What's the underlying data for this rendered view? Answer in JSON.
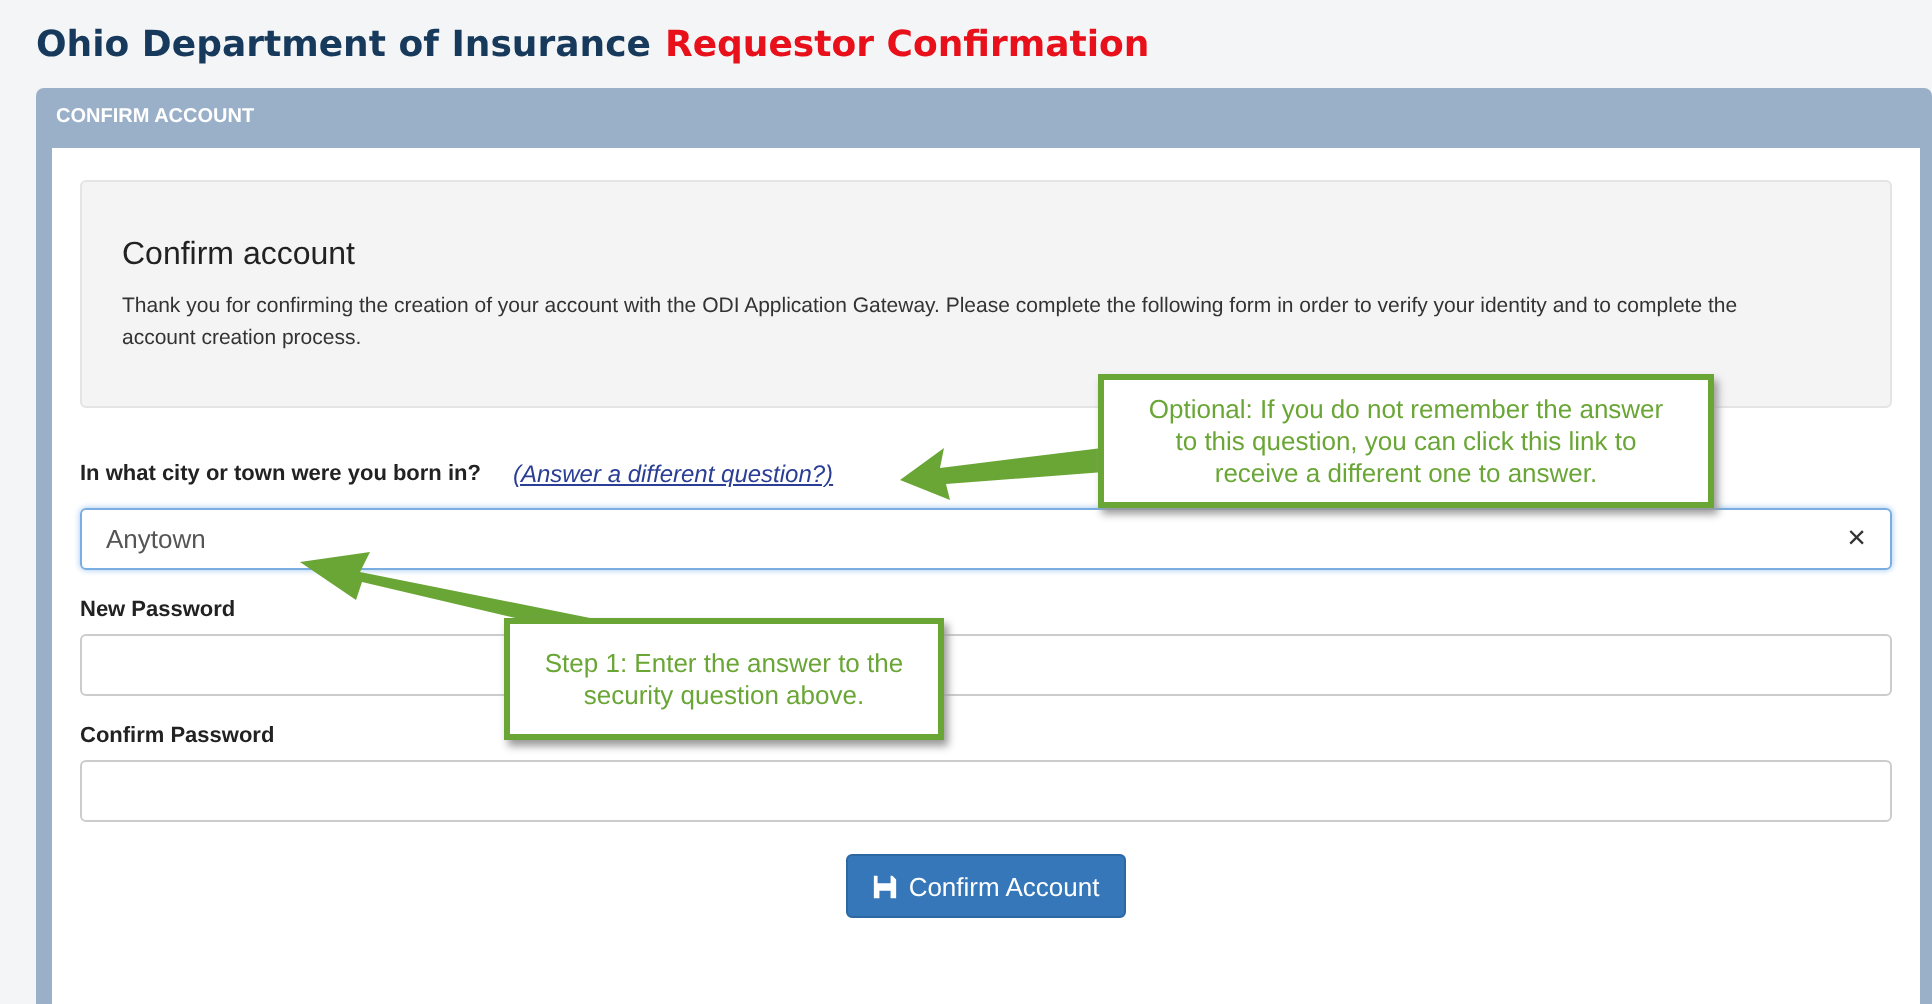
{
  "header": {
    "organization": "Ohio Department of Insurance",
    "page": "Requestor Confirmation"
  },
  "panel": {
    "title": "CONFIRM ACCOUNT"
  },
  "intro": {
    "heading": "Confirm account",
    "text": "Thank you for confirming the creation of your account with the ODI Application Gateway. Please complete the following form in order to verify your identity and to complete the account creation process."
  },
  "fields": [
    {
      "kind": "question",
      "label": "In what city or town were you born in?",
      "link": "(Answer a different question?)",
      "value": "Anytown",
      "clear": "×"
    },
    {
      "kind": "password",
      "label": "New Password"
    },
    {
      "kind": "password",
      "label": "Confirm Password"
    }
  ],
  "submit": {
    "label": "Confirm Account"
  },
  "callouts": [
    {
      "text": "Optional: If you do not remember the answer to this question, you can click this link to receive a different one to answer."
    },
    {
      "text": "Step 1: Enter the answer to the security question above."
    }
  ]
}
